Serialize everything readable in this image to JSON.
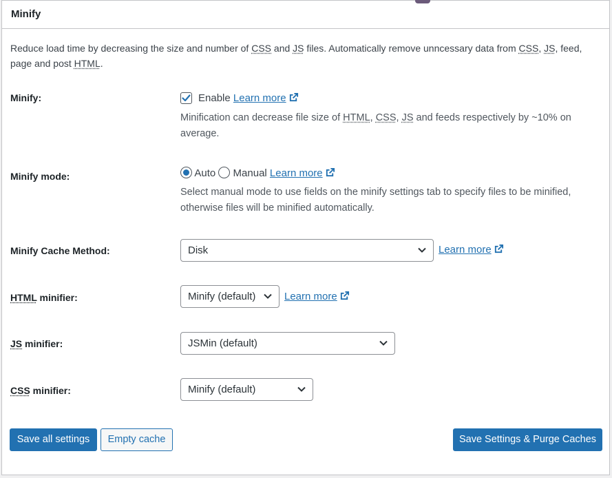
{
  "panel": {
    "title": "Minify"
  },
  "description": {
    "part1": "Reduce load time by decreasing the size and number of ",
    "abbr_css": "CSS",
    "and": " and ",
    "abbr_js": "JS",
    "part2": " files. Automatically remove unncessary data from ",
    "abbr_css2": "CSS",
    "comma": ", ",
    "abbr_js2": "JS",
    "part3": ", feed, page and post ",
    "abbr_html": "HTML",
    "end": "."
  },
  "minify": {
    "label": "Minify:",
    "enable_label": "Enable",
    "checked": true,
    "learn_more": "Learn more",
    "help_part1": "Minification can decrease file size of ",
    "help_html": "HTML",
    "help_comma1": ", ",
    "help_css": "CSS",
    "help_comma2": ", ",
    "help_js": "JS",
    "help_part2": " and feeds respectively by ~10% on average."
  },
  "minify_mode": {
    "label": "Minify mode:",
    "option_auto": "Auto",
    "option_manual": "Manual",
    "selected": "Auto",
    "learn_more": "Learn more",
    "help": "Select manual mode to use fields on the minify settings tab to specify files to be minified, otherwise files will be minified automatically."
  },
  "cache_method": {
    "label": "Minify Cache Method:",
    "value": "Disk",
    "learn_more": "Learn more"
  },
  "html_minifier": {
    "label_abbr": "HTML",
    "label_rest": " minifier:",
    "value": "Minify (default)",
    "learn_more": "Learn more"
  },
  "js_minifier": {
    "label_abbr": "JS",
    "label_rest": " minifier:",
    "value": "JSMin (default)"
  },
  "css_minifier": {
    "label_abbr": "CSS",
    "label_rest": " minifier:",
    "value": "Minify (default)"
  },
  "buttons": {
    "save_all": "Save all settings",
    "empty_cache": "Empty cache",
    "save_purge": "Save Settings & Purge Caches"
  },
  "colors": {
    "accent": "#2271b1",
    "border": "#c3c4c7",
    "text": "#1d2327",
    "muted": "#50575e"
  }
}
